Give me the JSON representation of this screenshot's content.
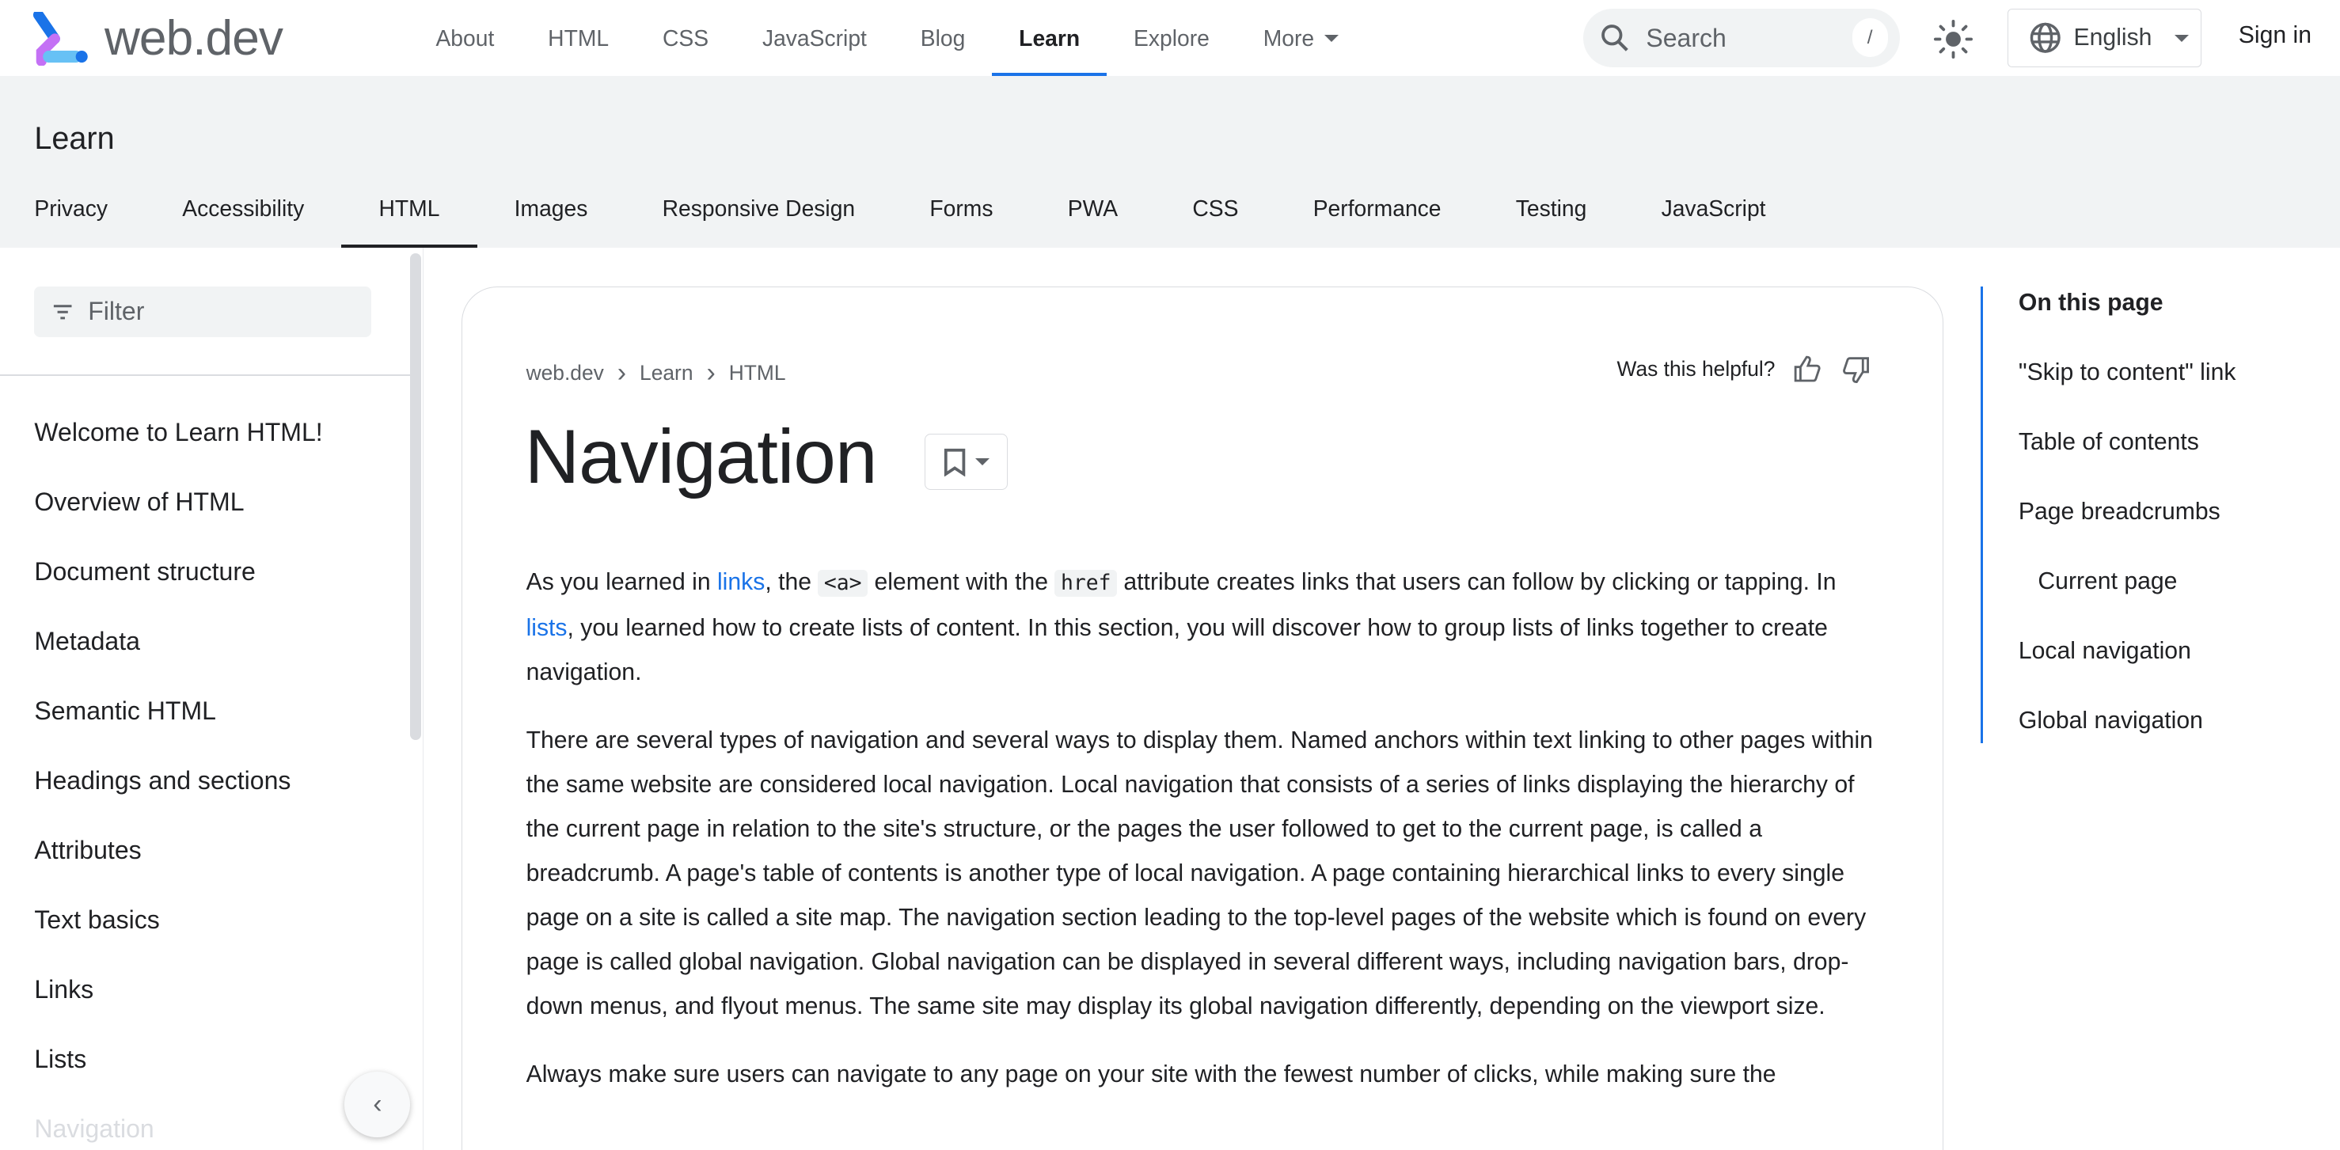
{
  "header": {
    "logo_text": "web.dev",
    "nav": [
      {
        "label": "About"
      },
      {
        "label": "HTML"
      },
      {
        "label": "CSS"
      },
      {
        "label": "JavaScript"
      },
      {
        "label": "Blog"
      },
      {
        "label": "Learn",
        "active": true
      },
      {
        "label": "Explore"
      },
      {
        "label": "More"
      }
    ],
    "search_placeholder": "Search",
    "search_shortcut": "/",
    "language": "English",
    "sign_in": "Sign in",
    "accent_color": "#1a73e8"
  },
  "section": {
    "title": "Learn",
    "tabs": [
      {
        "label": "Privacy"
      },
      {
        "label": "Accessibility"
      },
      {
        "label": "HTML",
        "active": true
      },
      {
        "label": "Images"
      },
      {
        "label": "Responsive Design"
      },
      {
        "label": "Forms"
      },
      {
        "label": "PWA"
      },
      {
        "label": "CSS"
      },
      {
        "label": "Performance"
      },
      {
        "label": "Testing"
      },
      {
        "label": "JavaScript"
      }
    ]
  },
  "sidebar": {
    "filter_placeholder": "Filter",
    "items": [
      "Welcome to Learn HTML!",
      "Overview of HTML",
      "Document structure",
      "Metadata",
      "Semantic HTML",
      "Headings and sections",
      "Attributes",
      "Text basics",
      "Links",
      "Lists",
      "Navigation"
    ]
  },
  "article": {
    "breadcrumbs": [
      "web.dev",
      "Learn",
      "HTML"
    ],
    "helpful_label": "Was this helpful?",
    "title": "Navigation",
    "p1": {
      "t1": "As you learned in ",
      "link1": "links",
      "t2": ", the ",
      "code1": "<a>",
      "t3": " element with the ",
      "code2": "href",
      "t4": " attribute creates links that users can follow by clicking or tapping. In ",
      "link2": "lists",
      "t5": ", you learned how to create lists of content. In this section, you will discover how to group lists of links together to create navigation."
    },
    "p2": "There are several types of navigation and several ways to display them. Named anchors within text linking to other pages within the same website are considered local navigation. Local navigation that consists of a series of links displaying the hierarchy of the current page in relation to the site's structure, or the pages the user followed to get to the current page, is called a breadcrumb. A page's table of contents is another type of local navigation. A page containing hierarchical links to every single page on a site is called a site map. The navigation section leading to the top-level pages of the website which is found on every page is called global navigation. Global navigation can be displayed in several different ways, including navigation bars, drop-down menus, and flyout menus. The same site may display its global navigation differently, depending on the viewport size.",
    "p3": "Always make sure users can navigate to any page on your site with the fewest number of clicks, while making sure the"
  },
  "toc": {
    "heading": "On this page",
    "items": [
      {
        "label": "\"Skip to content\" link"
      },
      {
        "label": "Table of contents"
      },
      {
        "label": "Page breadcrumbs"
      },
      {
        "label": "Current page",
        "sub": true
      },
      {
        "label": "Local navigation"
      },
      {
        "label": "Global navigation"
      }
    ]
  }
}
